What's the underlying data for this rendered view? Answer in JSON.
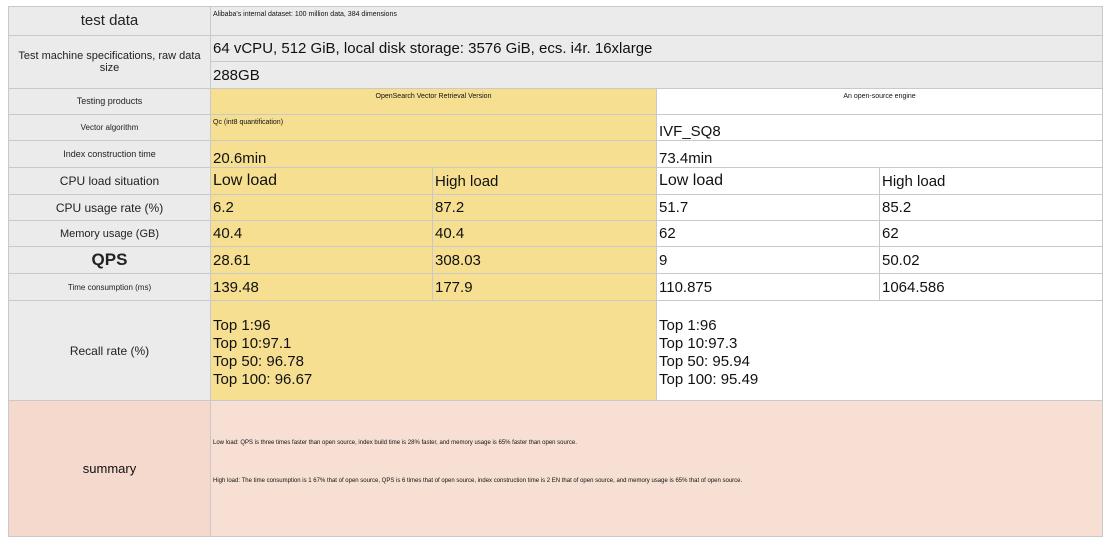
{
  "rows": {
    "test_data": {
      "label": "test data",
      "value": "Alibaba's internal dataset: 100 million data, 384 dimensions"
    },
    "machine": {
      "label": "Test machine specifications, raw data size",
      "spec": "64 vCPU, 512 GiB, local disk storage: 3576 GiB, ecs. i4r. 16xlarge",
      "size": "288GB"
    },
    "products": {
      "label": "Testing products",
      "opensearch": "OpenSearch Vector Retrieval Version",
      "opensource": "An open-source engine"
    },
    "algorithm": {
      "label": "Vector algorithm",
      "opensearch": "Qc (int8 quantification)",
      "opensource": "IVF_SQ8"
    },
    "index_time": {
      "label": "Index construction time",
      "opensearch": "20.6min",
      "opensource": "73.4min"
    },
    "cpu_load": {
      "label": "CPU load situation",
      "low": "Low load",
      "high": "High load"
    },
    "cpu_usage": {
      "label": "CPU usage rate (%)",
      "os_low": "6.2",
      "os_high": "87.2",
      "src_low": "51.7",
      "src_high": "85.2"
    },
    "memory": {
      "label": "Memory usage (GB)",
      "os_low": "40.4",
      "os_high": "40.4",
      "src_low": "62",
      "src_high": "62"
    },
    "qps": {
      "label": "QPS",
      "os_low": "28.61",
      "os_high": "308.03",
      "src_low": "9",
      "src_high": "50.02"
    },
    "time": {
      "label": "Time consumption (ms)",
      "os_low": "139.48",
      "os_high": "177.9",
      "src_low": "110.875",
      "src_high": "1064.586"
    },
    "recall": {
      "label": "Recall rate (%)",
      "opensearch": [
        "Top 1:96",
        "Top 10:97.1",
        "Top 50: 96.78",
        "Top 100: 96.67"
      ],
      "opensource": [
        "Top 1:96",
        "Top 10:97.3",
        "Top 50: 95.94",
        "Top 100: 95.49"
      ]
    },
    "summary": {
      "label": "summary",
      "low": "Low load: QPS is three times faster than open source, index build time is 28% faster, and memory usage is 65% faster than open source.",
      "high": "High load: The time consumption is 1 67% that of open source, QPS is 6 times that of open source, index construction time is 2 EN that of open source, and memory usage is 65% that of open source."
    }
  },
  "colors": {
    "opensearch_bg": "#f6df91",
    "label_bg": "#ebebeb",
    "summary_bg": "#f7dfd3"
  }
}
